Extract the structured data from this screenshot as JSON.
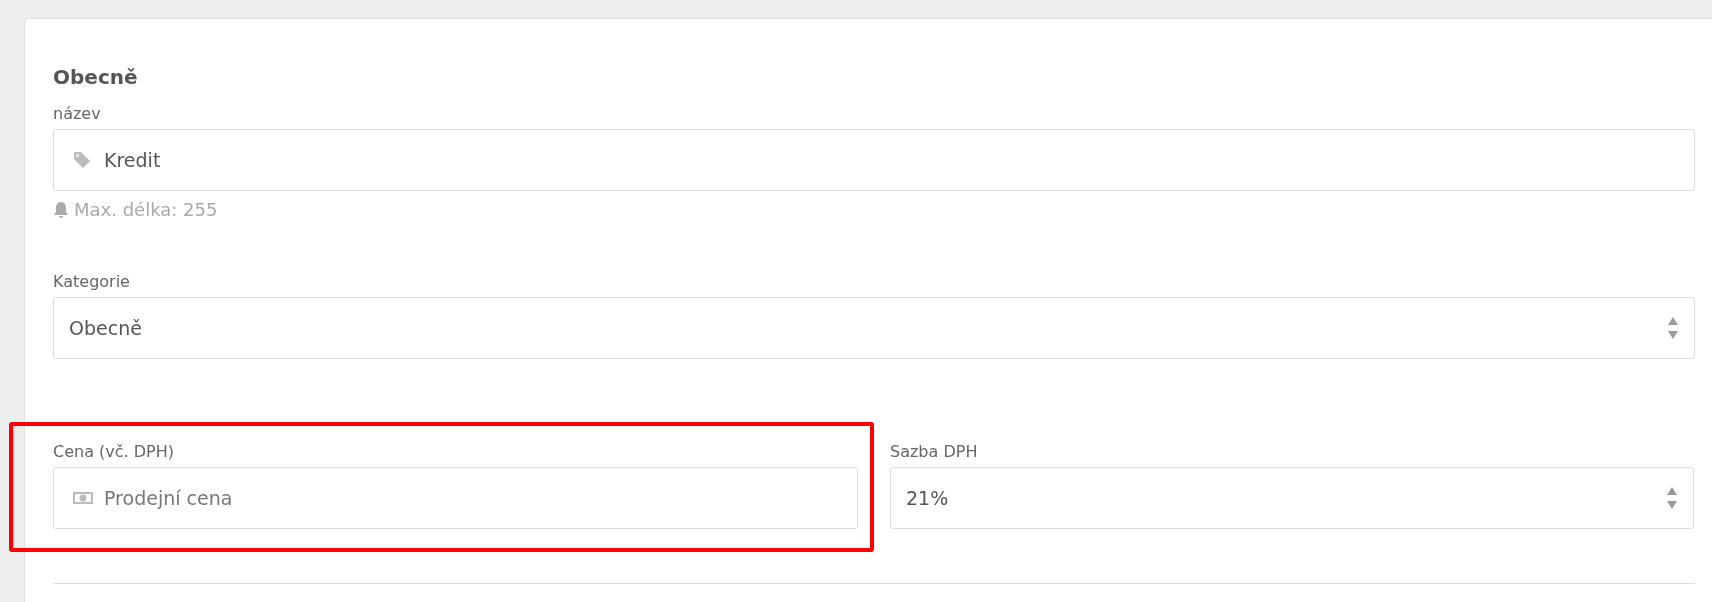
{
  "section": {
    "title": "Obecně"
  },
  "name_field": {
    "label": "název",
    "value": "Kredit",
    "hint": "Max. délka: 255"
  },
  "category": {
    "label": "Kategorie",
    "value": "Obecně"
  },
  "price": {
    "label": "Cena (vč. DPH)",
    "placeholder": "Prodejní cena",
    "highlighted": true
  },
  "vat": {
    "label": "Sazba DPH",
    "value": "21%"
  }
}
